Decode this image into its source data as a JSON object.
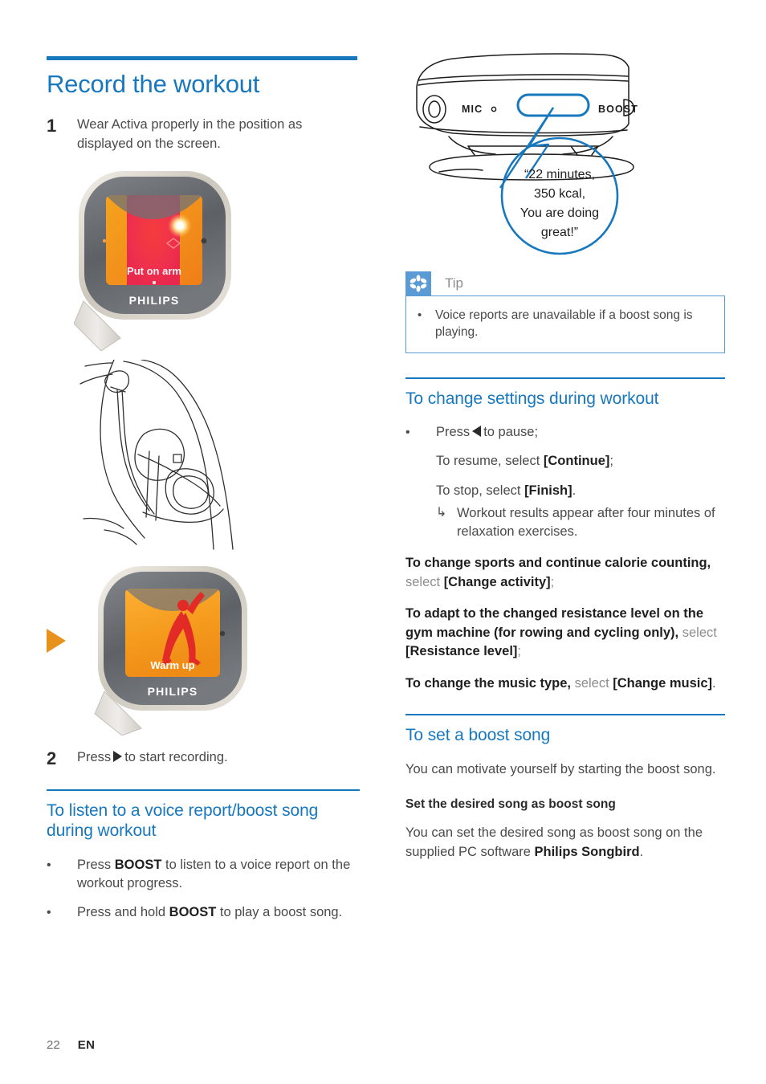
{
  "page": {
    "title": "Record the workout",
    "footer_page_number": "22",
    "footer_language": "EN",
    "accent_blue": "#1878be",
    "tip_blue": "#5b9bd5",
    "orange_cue": "#e8921e"
  },
  "left_column": {
    "step1": {
      "number": "1",
      "text": "Wear Activa properly in the position as displayed on the screen."
    },
    "figure_put_on_arm": {
      "screen_text": "Put on arm",
      "brand": "PHILIPS",
      "caption": "Philips Activa armband device showing Put on arm screen"
    },
    "figure_armband_worn": {
      "caption": "Line drawing of the armband worn on the upper arm with earphones"
    },
    "figure_warm_up": {
      "screen_text": "Warm up",
      "brand": "PHILIPS",
      "cue_icon": "play-triangle-icon",
      "caption": "Philips Activa armband device showing Warm up screen"
    },
    "step2": {
      "number": "2",
      "text_before": "Press",
      "icon": "play-triangle-icon",
      "text_after": "to start recording."
    },
    "section_voice_report": {
      "heading": "To listen to a voice report/boost song during workout",
      "bullets": [
        {
          "dot": "•",
          "before": "Press ",
          "bold": "BOOST",
          "after": " to listen to a voice report on the workout progress."
        },
        {
          "dot": "•",
          "before": "Press and hold ",
          "bold": "BOOST",
          "after": " to play a boost song."
        }
      ]
    }
  },
  "right_column": {
    "figure_device_side": {
      "label_mic": "MIC",
      "label_boost": "BOOST",
      "caption": "Side view line drawing of the device showing MIC and BOOST button"
    },
    "speech_bubble": {
      "line1": "“22 minutes,",
      "line2": "350 kcal,",
      "line3": "You are doing",
      "line4": "great!”"
    },
    "tip": {
      "icon": "asterisk-icon",
      "label": "Tip",
      "bullet_dot": "•",
      "text": "Voice reports are unavailable if a boost song is playing."
    },
    "section_change_settings": {
      "heading": "To change settings during workout",
      "bullet_dot": "•",
      "press_before": "Press",
      "press_icon": "pause-left-triangle-icon",
      "press_after": "to pause;",
      "resume_before": "To resume, select ",
      "resume_bold": "[Continue]",
      "resume_after": ";",
      "stop_before": "To stop, select ",
      "stop_bold": "[Finish]",
      "stop_after": ".",
      "result_arrow": "↳",
      "result_text": "Workout results appear after four minutes of relaxation exercises.",
      "para_sports_bold1": "To change sports and continue calorie counting,",
      "para_sports_lite": " select ",
      "para_sports_bold2": "[Change activity]",
      "para_sports_end": ";",
      "para_resist_bold1": "To adapt to the changed resistance level on the gym machine (for rowing and cycling only),",
      "para_resist_lite": " select ",
      "para_resist_bold2": "[Resistance level]",
      "para_resist_end": ";",
      "para_music_bold1": "To change the music type,",
      "para_music_lite": " select ",
      "para_music_bold2": "[Change music]",
      "para_music_end": "."
    },
    "section_boost_song": {
      "heading": "To set a boost song",
      "intro": "You can motivate yourself by starting the boost song.",
      "sub_heading": "Set the desired song as boost song",
      "body_before": "You can set the desired song as boost song on the supplied PC software ",
      "body_bold": "Philips Songbird",
      "body_after": "."
    }
  }
}
